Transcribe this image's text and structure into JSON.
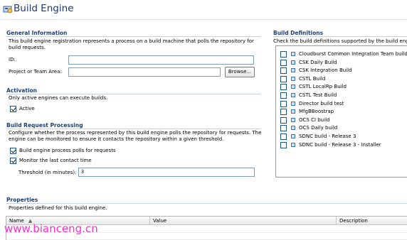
{
  "header": {
    "title": "Build Engine",
    "icon": "build-engine-icon"
  },
  "general": {
    "title": "General Information",
    "description": "This build engine registration represents a process on a build machine that polls the repository for build requests.",
    "id_label": "ID:",
    "id_value": "",
    "project_label": "Project or Team Area:",
    "project_value": "",
    "browse_label": "Browse..."
  },
  "activation": {
    "title": "Activation",
    "description": "Only active engines can execute builds.",
    "active_label": "Active",
    "active_checked": true
  },
  "build_request": {
    "title": "Build Request Processing",
    "description_line1": "Configure whether the process represented by this build engine polls the repository for requests. The",
    "description_line2": "engine can be monitored to ensure it contacts the repository within a given threshold.",
    "poll_label": "Build engine process polls for requests",
    "poll_checked": true,
    "monitor_label": "Monitor the last contact time",
    "monitor_checked": true,
    "threshold_label": "Threshold (in minutes):",
    "threshold_value": "3"
  },
  "build_definitions": {
    "title": "Build Definitions",
    "description": "Check the build definitions supported by the build engine",
    "items": [
      {
        "label": "Cloudburst Common Integration Team build",
        "checked": false
      },
      {
        "label": "CSK Daily Build",
        "checked": false
      },
      {
        "label": "CSK Integration Build",
        "checked": false
      },
      {
        "label": "CSTL Build",
        "checked": false
      },
      {
        "label": "CSTL LocalRp Build",
        "checked": false
      },
      {
        "label": "CSTL Test Build",
        "checked": false
      },
      {
        "label": "Director  build test",
        "checked": false
      },
      {
        "label": "MfgBBoostrap",
        "checked": false
      },
      {
        "label": "OCS CI build",
        "checked": false
      },
      {
        "label": "OCS Daily build",
        "checked": false
      },
      {
        "label": "SDNC build - Release 3",
        "checked": false
      },
      {
        "label": "SDNC build - Release 3 - Installer",
        "checked": false
      }
    ]
  },
  "properties": {
    "title": "Properties",
    "description": "Properties defined for this build engine.",
    "columns": [
      "Name",
      "Value",
      "Description"
    ],
    "rows": []
  },
  "watermark": "www.bianceng.cn",
  "colors": {
    "section_title": "#1f3f7a",
    "title_text": "#1f3a68",
    "watermark": "#ff2bd0"
  }
}
